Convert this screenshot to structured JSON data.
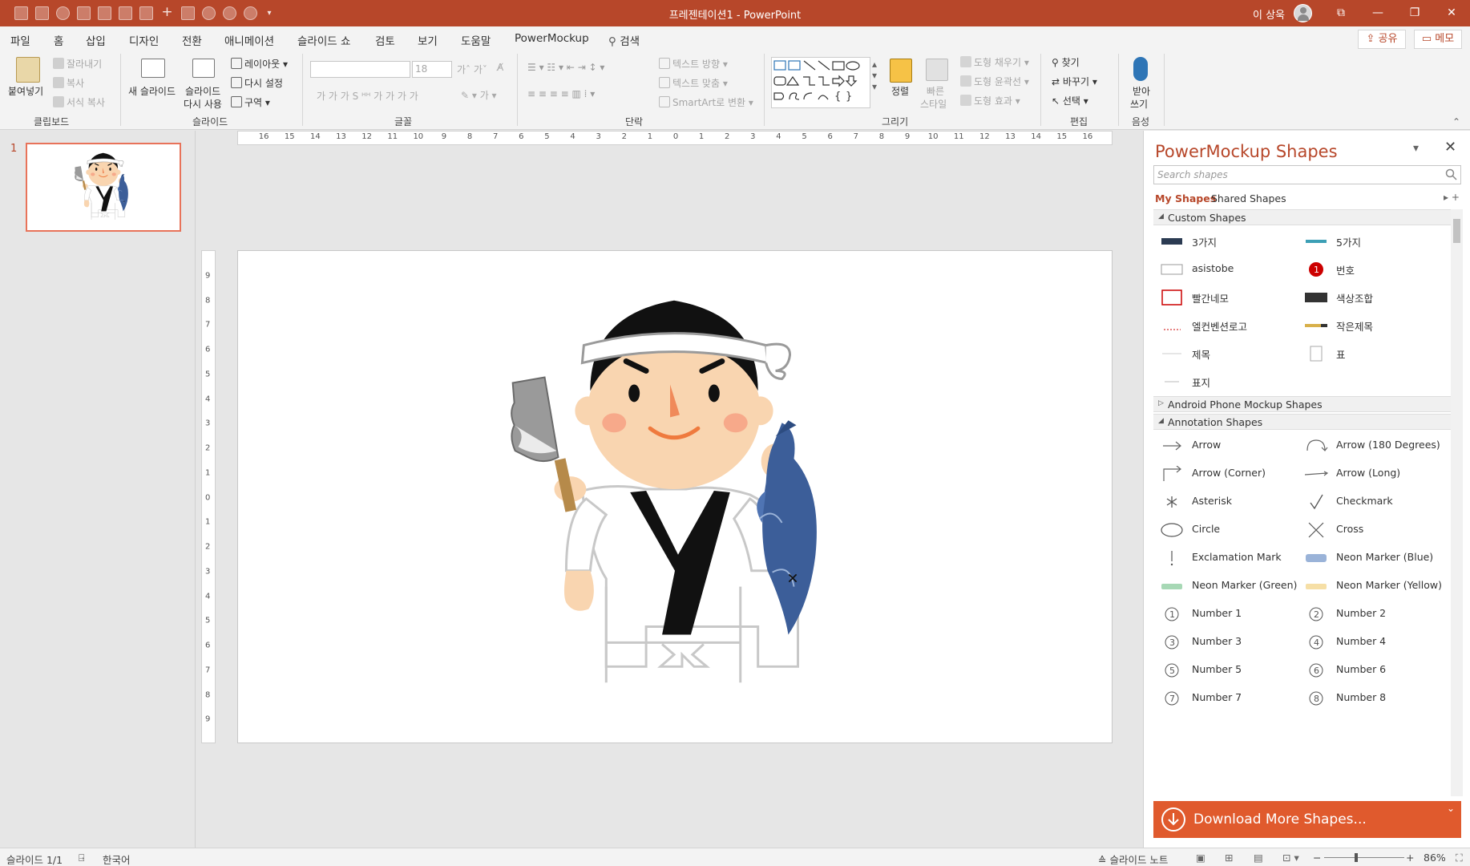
{
  "window": {
    "title": "프레젠테이션1  -  PowerPoint",
    "user": "이 상욱",
    "controls": [
      "⧉",
      "—",
      "❐",
      "✕"
    ]
  },
  "menu": {
    "tabs": [
      "파일",
      "홈",
      "삽입",
      "디자인",
      "전환",
      "애니메이션",
      "슬라이드 쇼",
      "검토",
      "보기",
      "도움말",
      "PowerMockup"
    ],
    "active_tab": "홈",
    "search": "검색",
    "share": "공유",
    "memo": "메모"
  },
  "ribbon": {
    "clipboard": {
      "paste": "붙여넣기",
      "cut": "잘라내기",
      "copy": "복사",
      "format_painter": "서식 복사",
      "label": "클립보드"
    },
    "slides": {
      "new_slide": "새 슬라이드",
      "reuse": "슬라이드",
      "reuse2": "다시 사용",
      "layout": "레이아웃",
      "reset": "다시 설정",
      "section": "구역",
      "label": "슬라이드"
    },
    "font": {
      "name_value": "",
      "size_value": "18",
      "label": "글꼴"
    },
    "paragraph": {
      "text_direction": "텍스트 방향",
      "align_text": "텍스트 맞춤",
      "smartart": "SmartArt로 변환",
      "label": "단락"
    },
    "drawing": {
      "arrange": "정렬",
      "quick_styles": "빠른",
      "quick_styles2": "스타일",
      "fill": "도형 채우기",
      "outline": "도형 윤곽선",
      "effects": "도형 효과",
      "label": "그리기"
    },
    "editing": {
      "find": "찾기",
      "replace": "바꾸기",
      "select": "선택",
      "label": "편집"
    },
    "voice": {
      "dictate": "받아",
      "dictate2": "쓰기",
      "label": "음성"
    }
  },
  "thumbnail": {
    "number": "1"
  },
  "ruler": {
    "h_ticks": [
      "16",
      "15",
      "14",
      "13",
      "12",
      "11",
      "10",
      "9",
      "8",
      "7",
      "6",
      "5",
      "4",
      "3",
      "2",
      "1",
      "0",
      "1",
      "2",
      "3",
      "4",
      "5",
      "6",
      "7",
      "8",
      "9",
      "10",
      "11",
      "12",
      "13",
      "14",
      "15",
      "16"
    ],
    "v_ticks": [
      "9",
      "8",
      "7",
      "6",
      "5",
      "4",
      "3",
      "2",
      "1",
      "0",
      "1",
      "2",
      "3",
      "4",
      "5",
      "6",
      "7",
      "8",
      "9"
    ]
  },
  "pane": {
    "title": "PowerMockup Shapes",
    "search_placeholder": "Search shapes",
    "my_shapes": "My Shapes",
    "shared_shapes": "Shared Shapes",
    "sections": [
      {
        "title": "Custom Shapes",
        "expanded": true,
        "items": [
          "3가지",
          "5가지",
          "asistobe",
          "번호",
          "빨간네모",
          "색상조합",
          "엘컨벤션로고",
          "작은제목",
          "제목",
          "표",
          "표지"
        ]
      },
      {
        "title": "Android Phone Mockup Shapes",
        "expanded": false,
        "items": []
      },
      {
        "title": "Annotation Shapes",
        "expanded": true,
        "items": [
          "Arrow",
          "Arrow (180 Degrees)",
          "Arrow (Corner)",
          "Arrow (Long)",
          "Asterisk",
          "Checkmark",
          "Circle",
          "Cross",
          "Exclamation Mark",
          "Neon Marker (Blue)",
          "Neon Marker (Green)",
          "Neon Marker (Yellow)",
          "Number 1",
          "Number 2",
          "Number 3",
          "Number 4",
          "Number 5",
          "Number 6",
          "Number 7",
          "Number 8"
        ]
      }
    ],
    "download": "Download More Shapes..."
  },
  "status": {
    "slide_info": "슬라이드 1/1",
    "language": "한국어",
    "notes": "슬라이드 노트",
    "zoom": "86%"
  },
  "colors": {
    "accent": "#b7472a",
    "download": "#e05a2d"
  }
}
